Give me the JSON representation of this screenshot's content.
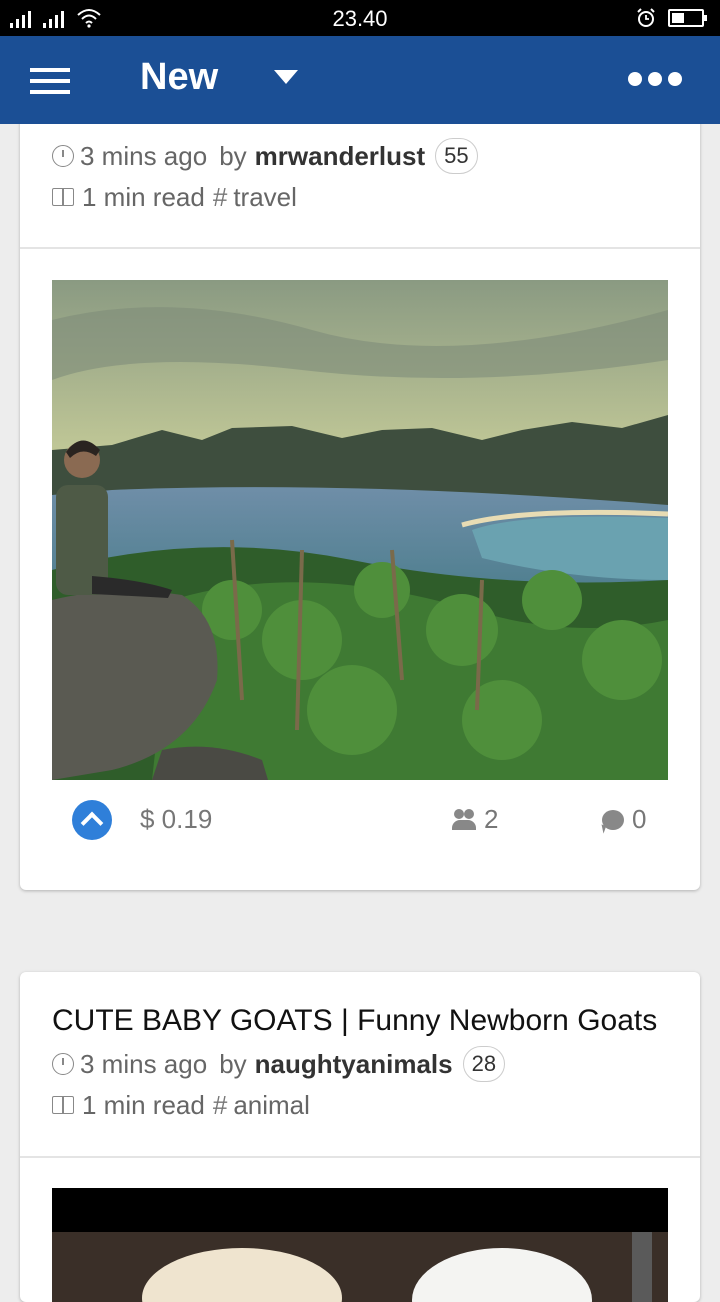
{
  "status_bar": {
    "time": "23.40"
  },
  "app_bar": {
    "title": "New"
  },
  "posts": [
    {
      "time_ago": "3 mins ago",
      "by_label": "by",
      "author": "mrwanderlust",
      "reputation": "55",
      "read_time": "1 min read",
      "tag": "travel",
      "payout": "$ 0.19",
      "voters": "2",
      "comments": "0"
    },
    {
      "title": "CUTE BABY GOATS | Funny Newborn Goats",
      "time_ago": "3 mins ago",
      "by_label": "by",
      "author": "naughtyanimals",
      "reputation": "28",
      "read_time": "1 min read",
      "tag": "animal"
    }
  ],
  "colors": {
    "app_bar": "#1b4f95",
    "upvote": "#2f7fd9",
    "status_bar": "#000000"
  }
}
